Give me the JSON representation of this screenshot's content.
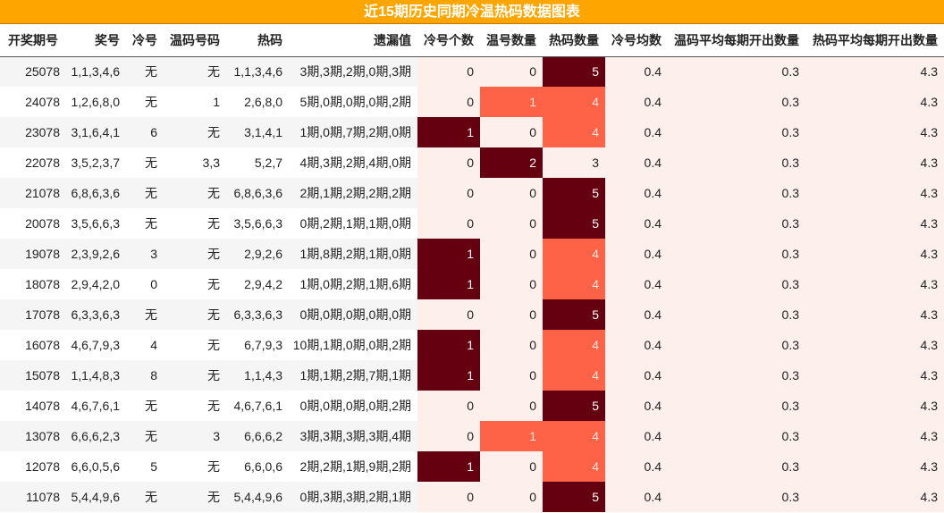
{
  "title": "近15期历史同期冷温热码数据图表",
  "columns": [
    "开奖期号",
    "奖号",
    "冷号",
    "温码号码",
    "热码",
    "遗漏值",
    "冷号个数",
    "温号数量",
    "热码数量",
    "冷号均数",
    "温码平均每期开出数量",
    "热码平均每期开出数量"
  ],
  "colors": {
    "header_bg": "#ffa500",
    "heat_low": "#fdf0ec",
    "heat_mid": "#ff6347",
    "heat_high": "#640010"
  },
  "rows": [
    [
      "25078",
      "1,1,3,4,6",
      "无",
      "无",
      "1,1,3,4,6",
      "3期,3期,2期,0期,3期",
      "0",
      "0",
      "5",
      "0.4",
      "0.3",
      "4.3"
    ],
    [
      "24078",
      "1,2,6,8,0",
      "无",
      "1",
      "2,6,8,0",
      "5期,0期,0期,0期,2期",
      "0",
      "1",
      "4",
      "0.4",
      "0.3",
      "4.3"
    ],
    [
      "23078",
      "3,1,6,4,1",
      "6",
      "无",
      "3,1,4,1",
      "1期,0期,7期,2期,0期",
      "1",
      "0",
      "4",
      "0.4",
      "0.3",
      "4.3"
    ],
    [
      "22078",
      "3,5,2,3,7",
      "无",
      "3,3",
      "5,2,7",
      "4期,3期,2期,4期,0期",
      "0",
      "2",
      "3",
      "0.4",
      "0.3",
      "4.3"
    ],
    [
      "21078",
      "6,8,6,3,6",
      "无",
      "无",
      "6,8,6,3,6",
      "2期,1期,2期,2期,2期",
      "0",
      "0",
      "5",
      "0.4",
      "0.3",
      "4.3"
    ],
    [
      "20078",
      "3,5,6,6,3",
      "无",
      "无",
      "3,5,6,6,3",
      "0期,2期,1期,1期,0期",
      "0",
      "0",
      "5",
      "0.4",
      "0.3",
      "4.3"
    ],
    [
      "19078",
      "2,3,9,2,6",
      "3",
      "无",
      "2,9,2,6",
      "1期,8期,2期,1期,0期",
      "1",
      "0",
      "4",
      "0.4",
      "0.3",
      "4.3"
    ],
    [
      "18078",
      "2,9,4,2,0",
      "0",
      "无",
      "2,9,4,2",
      "1期,0期,2期,1期,6期",
      "1",
      "0",
      "4",
      "0.4",
      "0.3",
      "4.3"
    ],
    [
      "17078",
      "6,3,3,6,3",
      "无",
      "无",
      "6,3,3,6,3",
      "0期,0期,0期,0期,0期",
      "0",
      "0",
      "5",
      "0.4",
      "0.3",
      "4.3"
    ],
    [
      "16078",
      "4,6,7,9,3",
      "4",
      "无",
      "6,7,9,3",
      "10期,1期,0期,0期,2期",
      "1",
      "0",
      "4",
      "0.4",
      "0.3",
      "4.3"
    ],
    [
      "15078",
      "1,1,4,8,3",
      "8",
      "无",
      "1,1,4,3",
      "1期,1期,2期,7期,1期",
      "1",
      "0",
      "4",
      "0.4",
      "0.3",
      "4.3"
    ],
    [
      "14078",
      "4,6,7,6,1",
      "无",
      "无",
      "4,6,7,6,1",
      "0期,0期,0期,0期,2期",
      "0",
      "0",
      "5",
      "0.4",
      "0.3",
      "4.3"
    ],
    [
      "13078",
      "6,6,6,2,3",
      "无",
      "3",
      "6,6,6,2",
      "3期,3期,3期,3期,4期",
      "0",
      "1",
      "4",
      "0.4",
      "0.3",
      "4.3"
    ],
    [
      "12078",
      "6,6,0,5,6",
      "5",
      "无",
      "6,6,0,6",
      "2期,2期,1期,9期,2期",
      "1",
      "0",
      "4",
      "0.4",
      "0.3",
      "4.3"
    ],
    [
      "11078",
      "5,4,4,9,6",
      "无",
      "无",
      "5,4,4,9,6",
      "0期,3期,3期,2期,1期",
      "0",
      "0",
      "5",
      "0.4",
      "0.3",
      "4.3"
    ]
  ]
}
